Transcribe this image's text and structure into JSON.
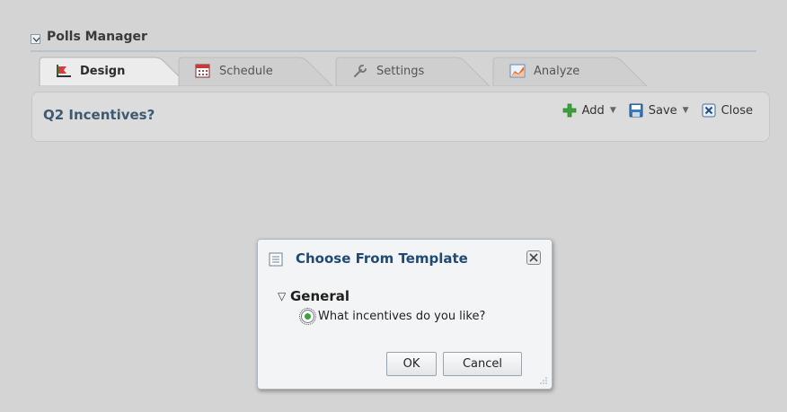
{
  "panel": {
    "title": "Polls Manager"
  },
  "tabs": [
    {
      "label": "Design",
      "icon": "design-icon",
      "active": true
    },
    {
      "label": "Schedule",
      "icon": "calendar-icon",
      "active": false
    },
    {
      "label": "Settings",
      "icon": "wrench-icon",
      "active": false
    },
    {
      "label": "Analyze",
      "icon": "chart-icon",
      "active": false
    }
  ],
  "content": {
    "title": "Q2 Incentives?",
    "toolbar": {
      "add_label": "Add",
      "save_label": "Save",
      "close_label": "Close"
    }
  },
  "dialog": {
    "title": "Choose From Template",
    "tree": {
      "node_label": "General",
      "item_label": "What incentives do you like?"
    },
    "ok_label": "OK",
    "cancel_label": "Cancel"
  },
  "colors": {
    "background": "#d4d4d4",
    "title_accent": "#3c5a72",
    "dialog_title": "#1e4a74",
    "add_green": "#3aa33a"
  }
}
